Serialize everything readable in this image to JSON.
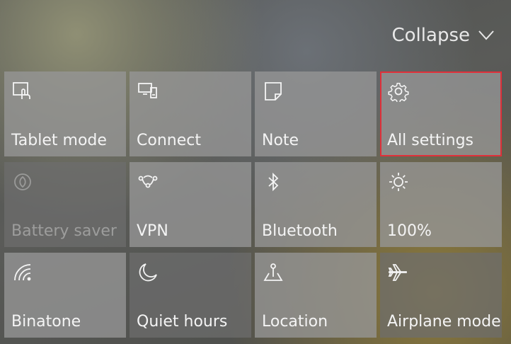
{
  "header": {
    "collapse_label": "Collapse",
    "collapse_icon": "chevron-down-icon"
  },
  "tiles": [
    {
      "label": "Tablet mode",
      "icon": "tablet-mode-icon"
    },
    {
      "label": "Connect",
      "icon": "connect-icon"
    },
    {
      "label": "Note",
      "icon": "note-icon"
    },
    {
      "label": "All settings",
      "icon": "gear-icon",
      "selected": true
    },
    {
      "label": "Battery saver",
      "icon": "battery-saver-icon",
      "disabled": true
    },
    {
      "label": "VPN",
      "icon": "vpn-icon"
    },
    {
      "label": "Bluetooth",
      "icon": "bluetooth-icon"
    },
    {
      "label": "100%",
      "icon": "brightness-icon"
    },
    {
      "label": "Binatone",
      "icon": "wifi-icon"
    },
    {
      "label": "Quiet hours",
      "icon": "moon-icon"
    },
    {
      "label": "Location",
      "icon": "location-icon"
    },
    {
      "label": "Airplane mode",
      "icon": "airplane-icon"
    }
  ],
  "colors": {
    "selection_border": "#e0303a"
  }
}
